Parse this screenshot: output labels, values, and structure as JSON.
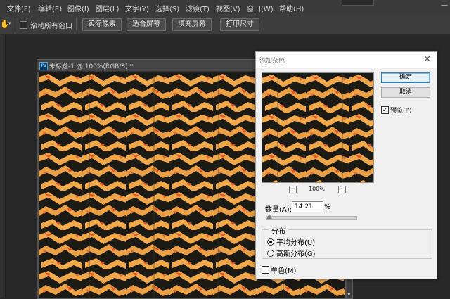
{
  "menu": {
    "items": [
      "文件(F)",
      "编辑(E)",
      "图像(I)",
      "图层(L)",
      "文字(Y)",
      "选择(S)",
      "滤镜(T)",
      "视图(V)",
      "窗口(W)",
      "帮助(H)"
    ],
    "window_controls": [
      "—",
      "□",
      "✕"
    ]
  },
  "options_bar": {
    "tool_icon": "hand-tool-icon",
    "scroll_all_label": "滚动所有窗口",
    "buttons": [
      "实际像素",
      "适合屏幕",
      "填充屏幕",
      "打印尺寸"
    ]
  },
  "document": {
    "badge": "Ps",
    "title": "未标题-1 @ 100%(RGB/8) *"
  },
  "dialog": {
    "title": "添加杂色",
    "close_glyph": "✕",
    "ok_label": "确定",
    "cancel_label": "取消",
    "preview_label": "预览(P)",
    "preview_checked": true,
    "zoom_out": "−",
    "zoom_in": "+",
    "zoom_level": "100%",
    "amount_label": "数量(A):",
    "amount_value": "14.21",
    "amount_unit": "%",
    "amount_slider_fraction": 0.0355,
    "distribution_title": "分布",
    "uniform_label": "平均分布(U)",
    "gaussian_label": "高斯分布(G)",
    "selected_distribution": "uniform",
    "monochromatic_label": "单色(M)",
    "monochromatic_checked": false
  },
  "colors": {
    "pattern_orange": "#f0a84a",
    "pattern_red": "#e5532a",
    "pattern_dark": "#1c1a14",
    "app_bg": "#282828",
    "dialog_bg": "#f0f0f0"
  }
}
